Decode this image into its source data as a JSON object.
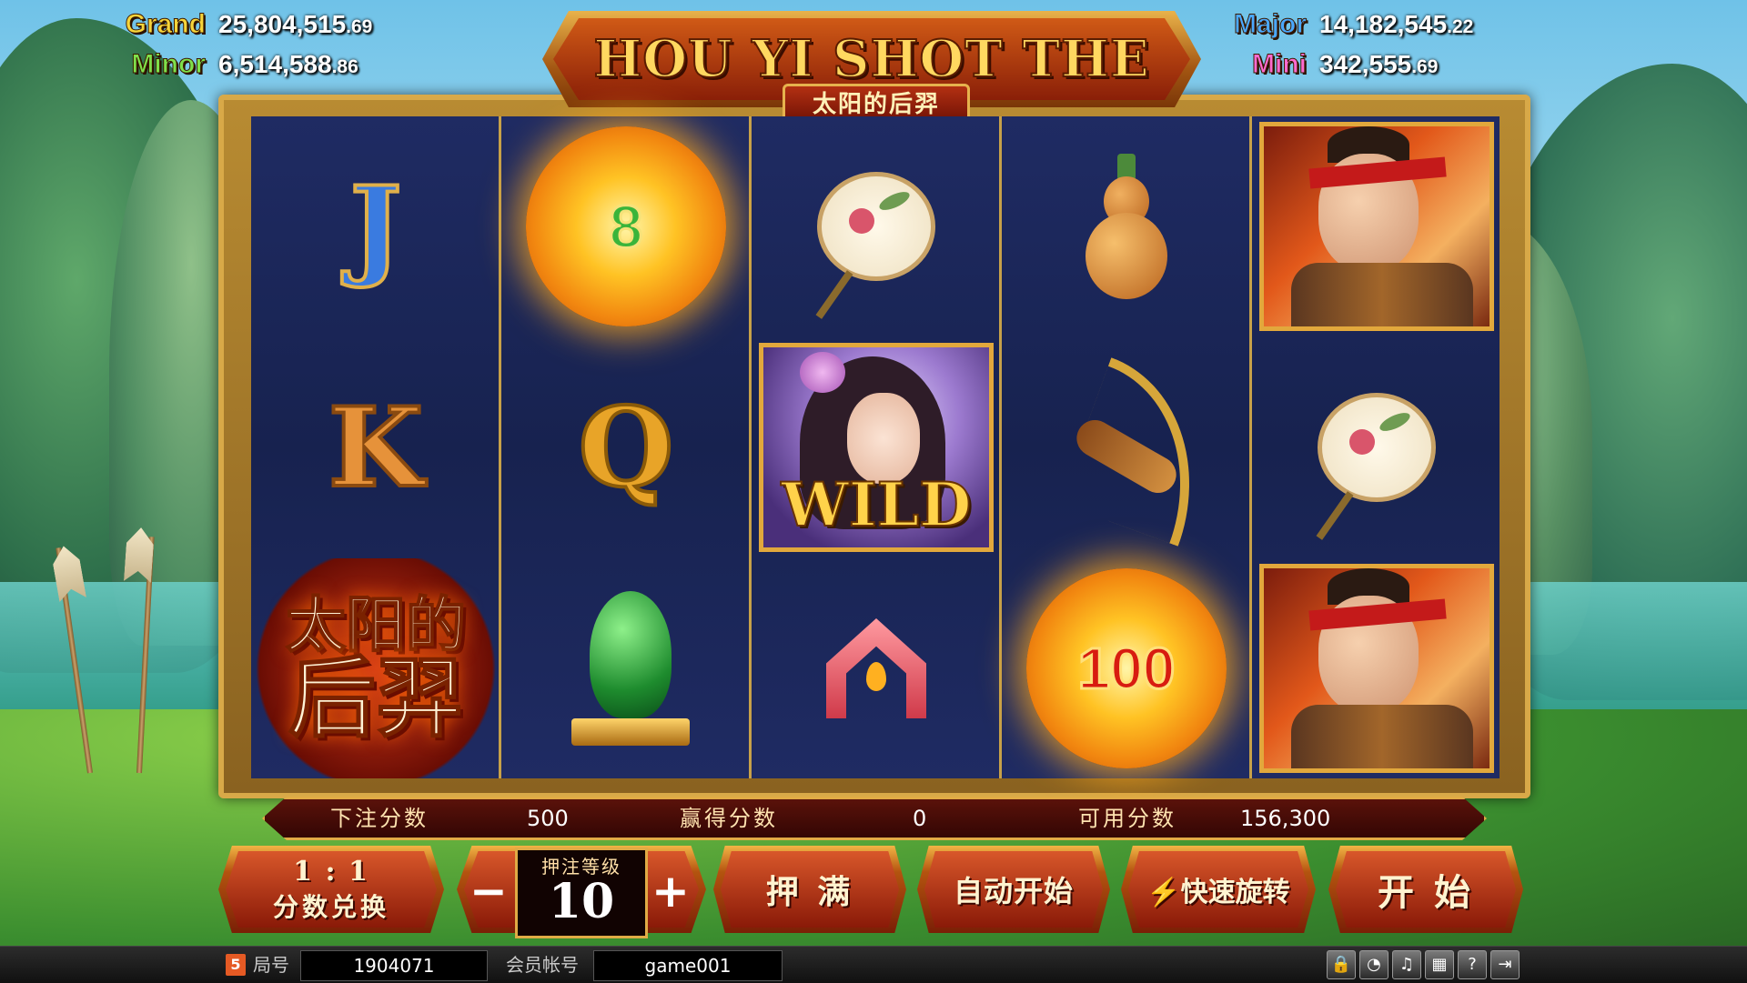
{
  "jackpots": {
    "grand": {
      "label": "Grand",
      "value_main": "25,804,515",
      "value_cents": ".69",
      "color": "#f7d43a"
    },
    "minor": {
      "label": "Minor",
      "value_main": "6,514,588",
      "value_cents": ".86",
      "color": "#7fe04a"
    },
    "major": {
      "label": "Major",
      "value_main": "14,182,545",
      "value_cents": ".22",
      "color": "#4aa8ff"
    },
    "mini": {
      "label": "Mini",
      "value_main": "342,555",
      "value_cents": ".69",
      "color": "#ff6ad0"
    }
  },
  "title": {
    "main": "HOU YI SHOT THE SUNS",
    "chinese": "太阳的后羿"
  },
  "reels": [
    [
      "J",
      "K",
      "scatter"
    ],
    [
      "sun-8",
      "Q",
      "jade-bird"
    ],
    [
      "fan",
      "wild",
      "arch"
    ],
    [
      "gourd",
      "bow",
      "sun-100"
    ],
    [
      "hero",
      "fan",
      "hero"
    ]
  ],
  "symbols": {
    "J": "J",
    "K": "K",
    "Q": "Q",
    "sun_8": "8",
    "sun_100": "100",
    "wild": "WILD",
    "scatter_line1": "太阳的",
    "scatter_line2": "后羿"
  },
  "info": {
    "bet_label": "下注分数",
    "bet_value": "500",
    "win_label": "赢得分数",
    "win_value": "0",
    "credit_label": "可用分数",
    "credit_value": "156,300"
  },
  "controls": {
    "ratio": "1 : 1",
    "exchange": "分数兑换",
    "minus": "−",
    "level_label": "押注等级",
    "level_value": "10",
    "plus": "+",
    "max_bet": "押 满",
    "auto_start": "自动开始",
    "turbo": "⚡快速旋转",
    "start": "开 始"
  },
  "status": {
    "html5_badge": "5",
    "table_label": "局号",
    "table_value": "1904071",
    "account_label": "会员帐号",
    "account_value": "game001",
    "tools": [
      "lock-icon",
      "rss-icon",
      "music-icon",
      "cast-icon",
      "help-icon",
      "exit-icon"
    ]
  }
}
